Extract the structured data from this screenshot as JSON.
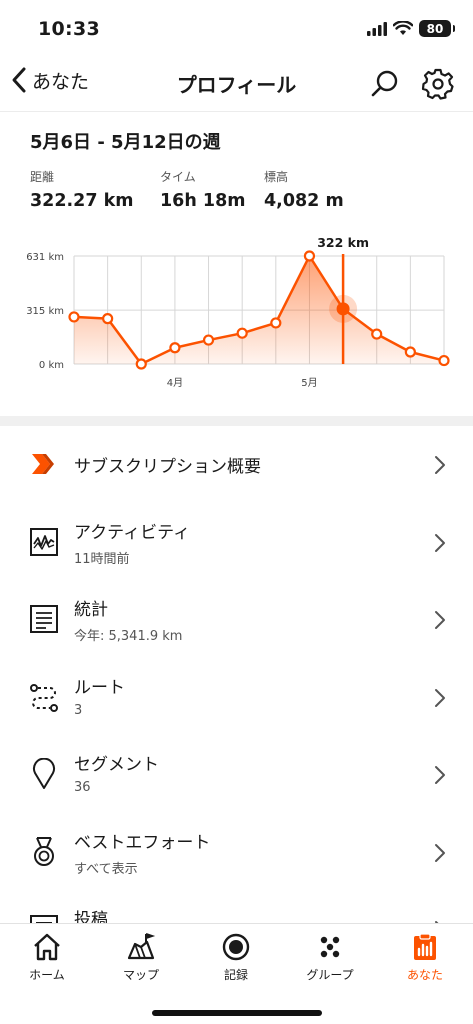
{
  "status_bar": {
    "time": "10:33",
    "battery": "80"
  },
  "nav": {
    "back_label": "あなた",
    "title": "プロフィール"
  },
  "summary": {
    "week_title": "5月6日 - 5月12日の週",
    "stats": [
      {
        "label": "距離",
        "value": "322.27 km"
      },
      {
        "label": "タイム",
        "value": "16h 18m"
      },
      {
        "label": "標高",
        "value": "4,082 m"
      }
    ]
  },
  "chart_data": {
    "type": "area",
    "y_unit": "km",
    "y_tick_labels": [
      "631 km",
      "315 km",
      "0 km"
    ],
    "y_ticks": [
      631,
      315,
      0
    ],
    "ylim": [
      0,
      631
    ],
    "x_tick_labels": [
      {
        "label": "4月",
        "index": 3
      },
      {
        "label": "5月",
        "index": 7
      }
    ],
    "values": [
      275,
      265,
      0,
      95,
      140,
      180,
      240,
      631,
      322,
      175,
      70,
      20
    ],
    "highlight_index": 8,
    "highlight_label": "322 km",
    "grid": true,
    "accent": "#fc5200"
  },
  "menu": [
    {
      "id": "subscription",
      "icon": "strava-chevron-icon",
      "title": "サブスクリプション概要",
      "sub": ""
    },
    {
      "id": "activities",
      "icon": "activity-graph-icon",
      "title": "アクティビティ",
      "sub": "11時間前"
    },
    {
      "id": "stats",
      "icon": "stats-list-icon",
      "title": "統計",
      "sub": "今年: 5,341.9 km"
    },
    {
      "id": "routes",
      "icon": "route-icon",
      "title": "ルート",
      "sub": "3"
    },
    {
      "id": "segments",
      "icon": "map-pin-icon",
      "title": "セグメント",
      "sub": "36"
    },
    {
      "id": "best-efforts",
      "icon": "medal-icon",
      "title": "ベストエフォート",
      "sub": "すべて表示"
    },
    {
      "id": "posts",
      "icon": "posts-icon",
      "title": "投稿",
      "sub": ""
    }
  ],
  "tabs": [
    {
      "id": "home",
      "icon": "home-icon",
      "label": "ホーム",
      "active": false
    },
    {
      "id": "map",
      "icon": "map-icon",
      "label": "マップ",
      "active": false
    },
    {
      "id": "record",
      "icon": "record-icon",
      "label": "記録",
      "active": false
    },
    {
      "id": "groups",
      "icon": "groups-icon",
      "label": "グループ",
      "active": false
    },
    {
      "id": "you",
      "icon": "you-icon",
      "label": "あなた",
      "active": true
    }
  ],
  "colors": {
    "accent": "#fc5200",
    "text": "#1a1a1a",
    "muted": "#555555"
  }
}
